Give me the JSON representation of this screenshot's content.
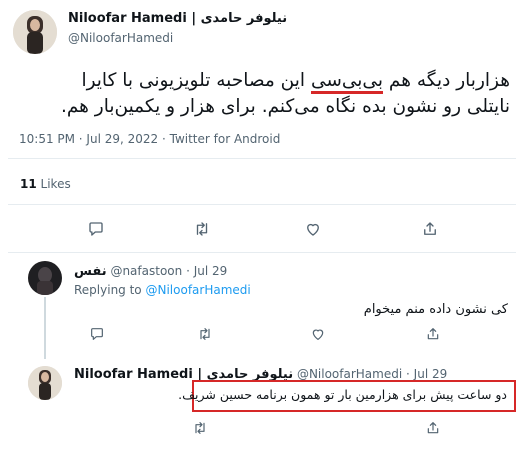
{
  "main_tweet": {
    "author_name": "Niloofar Hamedi",
    "author_separator": "|",
    "author_name_fa": "نیلوفر حامدی",
    "handle": "@NiloofarHamedi",
    "text_line1_prefix": "هزاربار دیگه هم ",
    "text_line1_underlined": "بی‌بی‌سی",
    "text_line1_suffix": " این مصاحبه تلویزیونی با کایرا",
    "text_line2": "نایتلی رو نشون بده نگاه می‌کنم. برای هزار و یکمین‌بار هم.",
    "timestamp": "10:51 PM · Jul 29, 2022 · Twitter for Android",
    "likes_count": "11",
    "likes_label": "Likes"
  },
  "reply1": {
    "author_name": "نفس",
    "handle": "@nafastoon",
    "dot": "·",
    "date": "Jul 29",
    "replying_prefix": "Replying to",
    "replying_handle": "@NiloofarHamedi",
    "text": "کی نشون داده منم میخوام"
  },
  "reply2": {
    "author_name": "Niloofar Hamedi",
    "author_separator": "|",
    "author_name_fa": "نیلوفر حامدی",
    "handle": "@NiloofarHamedi",
    "dot": "·",
    "date": "Jul 29",
    "text": "دو ساعت پیش برای هزارمین بار تو همون برنامه حسین شریف."
  },
  "colors": {
    "link_blue": "#1d9bf0",
    "annotation_red": "#d62828",
    "muted_gray": "#536471"
  },
  "icons": [
    "reply-icon",
    "retweet-icon",
    "like-icon",
    "share-icon"
  ]
}
